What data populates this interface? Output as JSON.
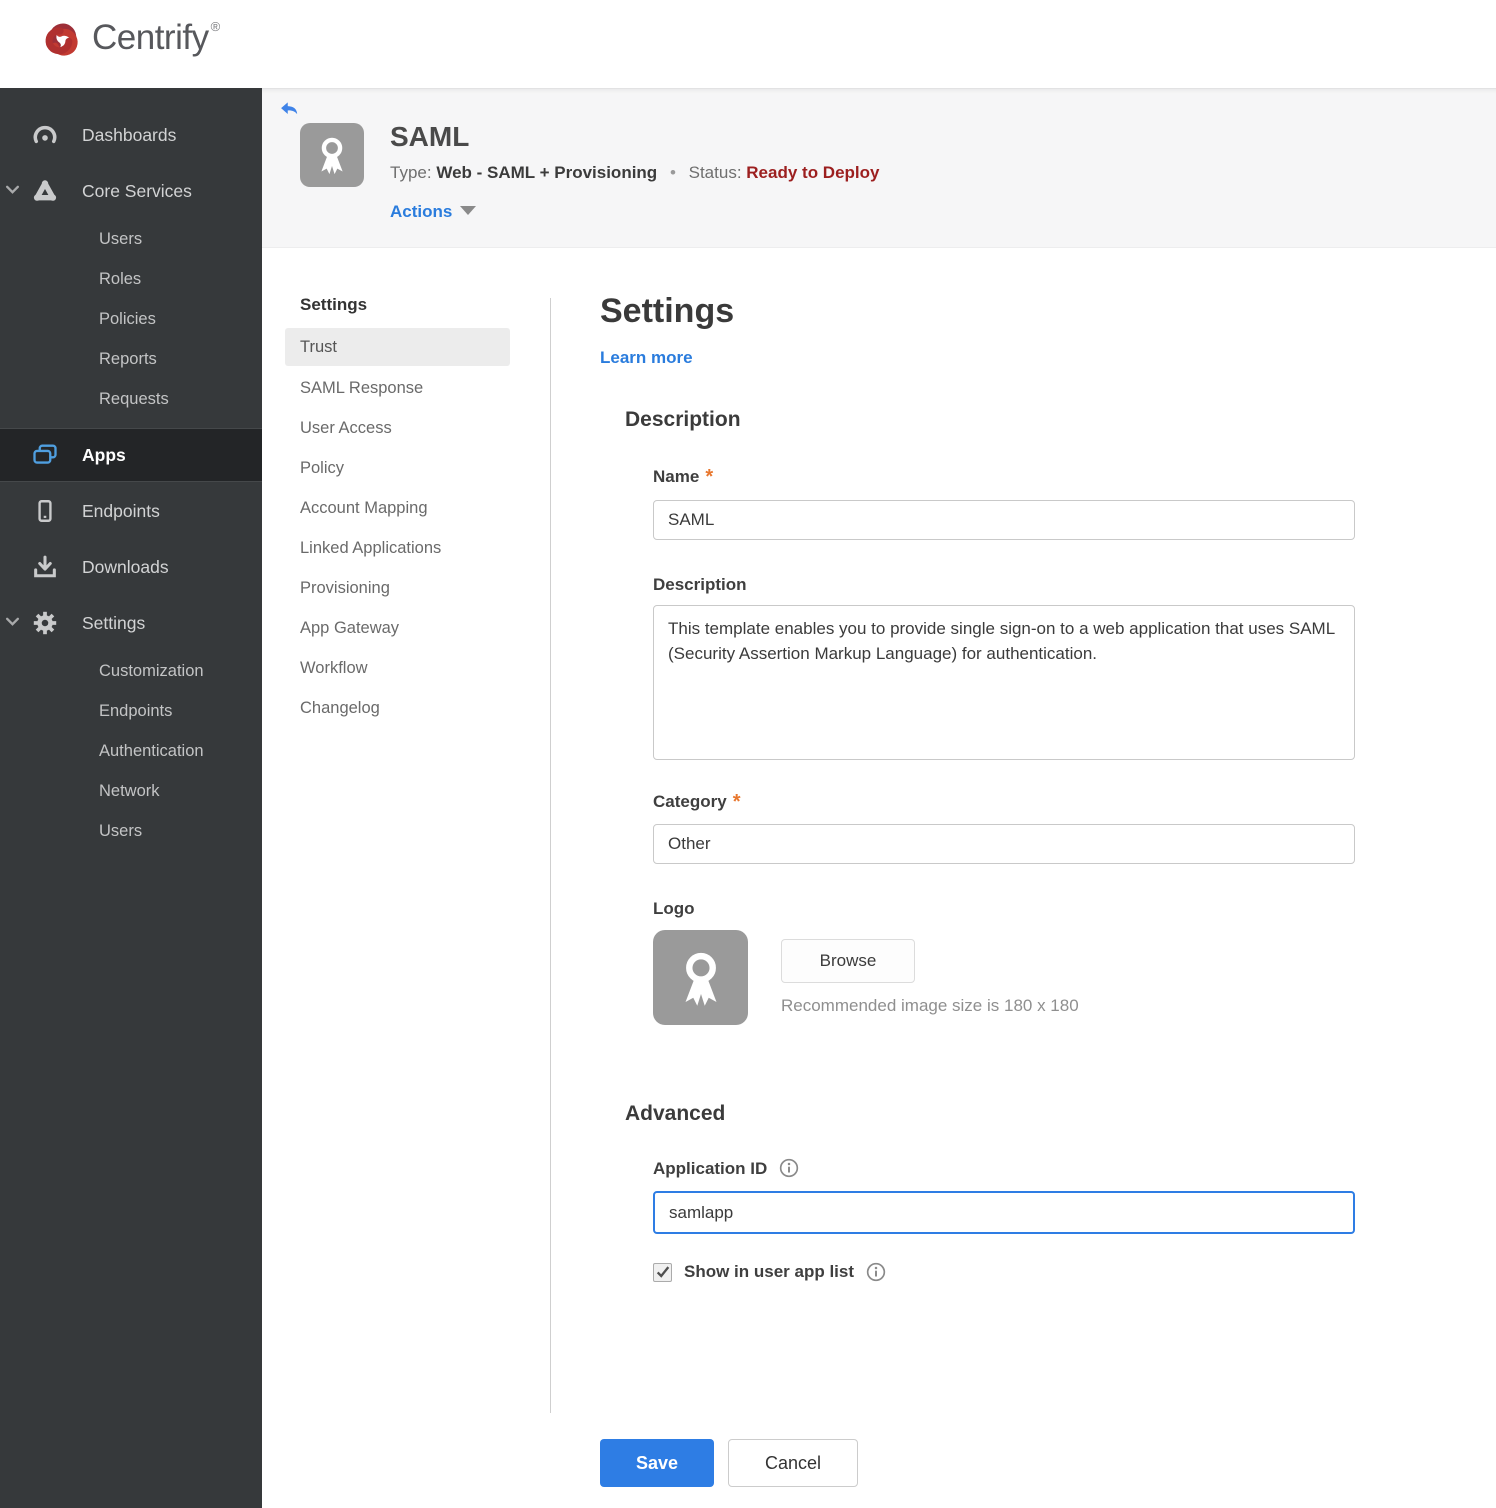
{
  "brand": {
    "name": "Centrify",
    "reg": "®"
  },
  "sidebar": {
    "items": [
      {
        "label": "Dashboards"
      },
      {
        "label": "Core Services",
        "expanded": true,
        "children": [
          "Users",
          "Roles",
          "Policies",
          "Reports",
          "Requests"
        ]
      },
      {
        "label": "Apps",
        "active": true
      },
      {
        "label": "Endpoints"
      },
      {
        "label": "Downloads"
      },
      {
        "label": "Settings",
        "expanded": true,
        "children": [
          "Customization",
          "Endpoints",
          "Authentication",
          "Network",
          "Users"
        ]
      }
    ]
  },
  "app_header": {
    "title": "SAML",
    "type_label": "Type:",
    "type_value": "Web - SAML + Provisioning",
    "separator": "•",
    "status_label": "Status:",
    "status_value": "Ready to Deploy",
    "actions_label": "Actions"
  },
  "subnav": {
    "header": "Settings",
    "selected": "Trust",
    "items": [
      "Trust",
      "SAML Response",
      "User Access",
      "Policy",
      "Account Mapping",
      "Linked Applications",
      "Provisioning",
      "App Gateway",
      "Workflow",
      "Changelog"
    ]
  },
  "main": {
    "title": "Settings",
    "learn_more_label": "Learn more",
    "required_marker": "*",
    "description": {
      "heading": "Description",
      "name_label": "Name",
      "name_value": "SAML",
      "description_label": "Description",
      "description_value": "This template enables you to provide single sign-on to a web application that uses SAML (Security Assertion Markup Language) for authentication.",
      "category_label": "Category",
      "category_value": "Other",
      "logo_label": "Logo",
      "browse_label": "Browse",
      "logo_hint": "Recommended image size is 180 x 180"
    },
    "advanced": {
      "heading": "Advanced",
      "app_id_label": "Application ID",
      "app_id_value": "samlapp",
      "show_in_app_list_label": "Show in user app list",
      "show_in_app_list_checked": true
    },
    "save_label": "Save",
    "cancel_label": "Cancel"
  },
  "colors": {
    "accent_blue": "#2e7de4",
    "link_blue": "#2a7cdd",
    "status_red": "#9c1f1f",
    "required_orange": "#e8772e",
    "brand_red": "#c0392b",
    "sidebar_bg": "#36393b",
    "header_bg": "#f6f6f7"
  },
  "icons": [
    "centrify-logo",
    "gauge-icon",
    "core-services-icon",
    "apps-icon",
    "endpoint-icon",
    "download-icon",
    "gear-icon",
    "chevron-down-icon",
    "back-arrow-icon",
    "award-ribbon-icon",
    "info-icon",
    "checkbox-check-icon",
    "dropdown-triangle-icon"
  ]
}
